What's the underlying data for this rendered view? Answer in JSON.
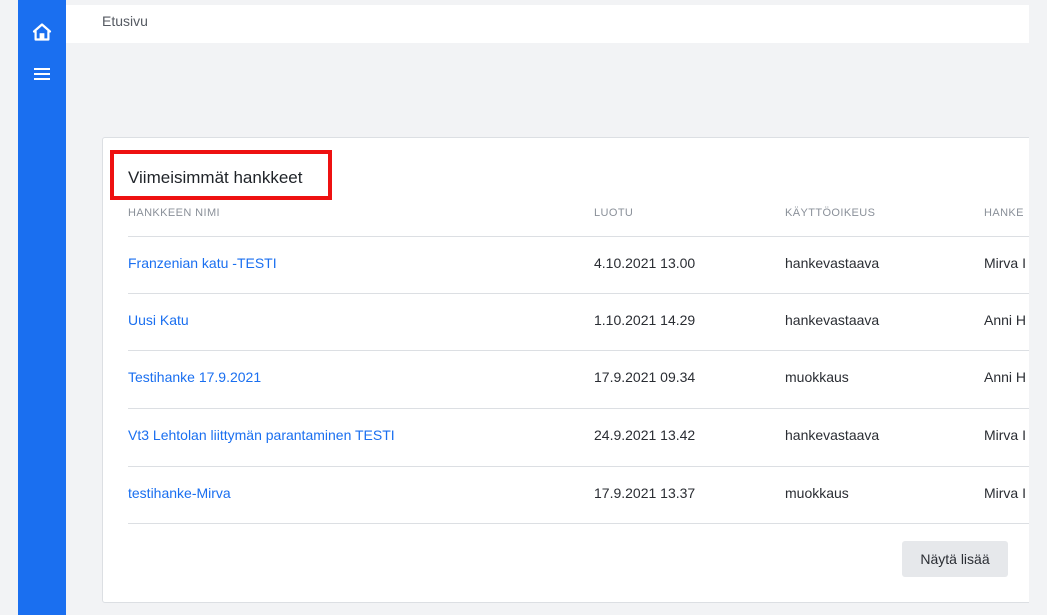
{
  "breadcrumb": "Etusivu",
  "colors": {
    "sidebar": "#1a6ff0",
    "link": "#1a6ff0",
    "highlight": "#ee1111",
    "background": "#f2f3f5"
  },
  "sidebar": {
    "icons": [
      "home-icon",
      "menu-icon"
    ]
  },
  "card": {
    "title": "Viimeisimmät hankkeet",
    "columns": [
      "HANKKEEN NIMI",
      "LUOTU",
      "KÄYTTÖOIKEUS",
      "HANKE"
    ],
    "rows": [
      {
        "name": "Franzenian katu -TESTI",
        "created": "4.10.2021 13.00",
        "access": "hankevastaava",
        "owner": "Mirva I"
      },
      {
        "name": "Uusi Katu",
        "created": "1.10.2021 14.29",
        "access": "hankevastaava",
        "owner": "Anni H"
      },
      {
        "name": "Testihanke 17.9.2021",
        "created": "17.9.2021 09.34",
        "access": "muokkaus",
        "owner": "Anni H"
      },
      {
        "name": "Vt3 Lehtolan liittymän parantaminen TESTI",
        "created": "24.9.2021 13.42",
        "access": "hankevastaava",
        "owner": "Mirva I"
      },
      {
        "name": "testihanke-Mirva",
        "created": "17.9.2021 13.37",
        "access": "muokkaus",
        "owner": "Mirva I"
      }
    ],
    "more_label": "Näytä lisää"
  }
}
